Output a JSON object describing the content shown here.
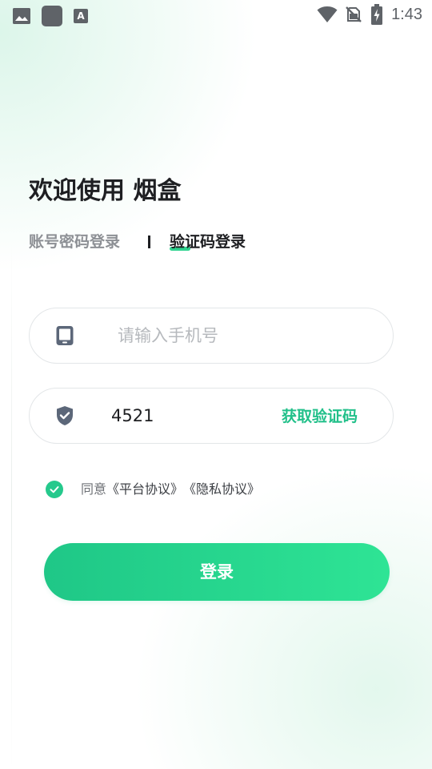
{
  "status_bar": {
    "time": "1:43",
    "left_icons": [
      "image-notification-icon",
      "app-notification-icon",
      "a-notification-icon"
    ],
    "a_icon_glyph": "A",
    "right_icons": [
      "wifi-icon",
      "no-sim-icon",
      "battery-charging-icon"
    ]
  },
  "header": {
    "title": "欢迎使用 烟盒"
  },
  "tabs": {
    "account_password": "账号密码登录",
    "verification_code": "验证码登录",
    "active": "verification_code"
  },
  "form": {
    "phone": {
      "placeholder": "请输入手机号",
      "value": "",
      "icon": "phone-icon"
    },
    "code": {
      "value": "4521",
      "icon": "shield-icon",
      "get_code_label": "获取验证码"
    }
  },
  "agreement": {
    "checked": true,
    "prefix": "同意",
    "platform_link": "《平台协议》",
    "privacy_link": "《隐私协议》"
  },
  "login_button": {
    "label": "登录"
  },
  "colors": {
    "accent": "#22c08a",
    "button_gradient_start": "#1fc787",
    "button_gradient_end": "#2ee495",
    "title_text": "#1e1f22",
    "inactive_tab_text": "#8d9095",
    "placeholder_text": "#b6b9bd"
  }
}
